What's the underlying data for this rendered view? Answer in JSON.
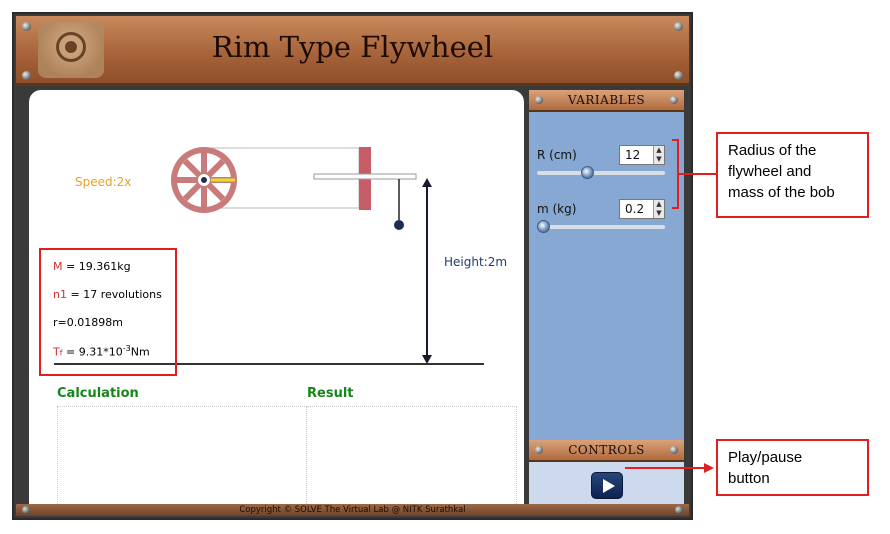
{
  "app": {
    "title": "Rim Type Flywheel",
    "footer": "Copyright © SOLVE The Virtual Lab @ NITK Surathkal"
  },
  "simulation": {
    "speed_label": "Speed:2x",
    "height_label": "Height:2m",
    "results": {
      "M": {
        "symbol": "M",
        "value": " = 19.361kg"
      },
      "n1": {
        "symbol": "n1",
        "value": " = 17 revolutions"
      },
      "r": {
        "value": "r=0.01898m"
      },
      "tf": {
        "symbol": "T",
        "sub": "f",
        "value_before": " = 9.31*10",
        "exponent": "-3",
        "value_after": "Nm"
      }
    },
    "calculation_header": "Calculation",
    "result_header": "Result"
  },
  "variables_panel": {
    "header": "VARIABLES",
    "radius": {
      "label": "R (cm)",
      "value": "12",
      "slider_fraction": 0.38
    },
    "mass": {
      "label": "m (kg)",
      "value": "0.2",
      "slider_fraction": 0.0
    }
  },
  "controls_panel": {
    "header": "CONTROLS",
    "play_icon": "play-icon"
  },
  "annotations": {
    "variables_note": [
      "Radius of the",
      "flywheel and",
      "mass of the bob"
    ],
    "play_note": [
      "Play/pause",
      "button"
    ]
  },
  "colors": {
    "header_brown": "#a8643a",
    "panel_blue": "#87a8d2",
    "annotation_red": "#e02020",
    "flywheel": "#c97a7a",
    "result_green": "#17861a"
  }
}
